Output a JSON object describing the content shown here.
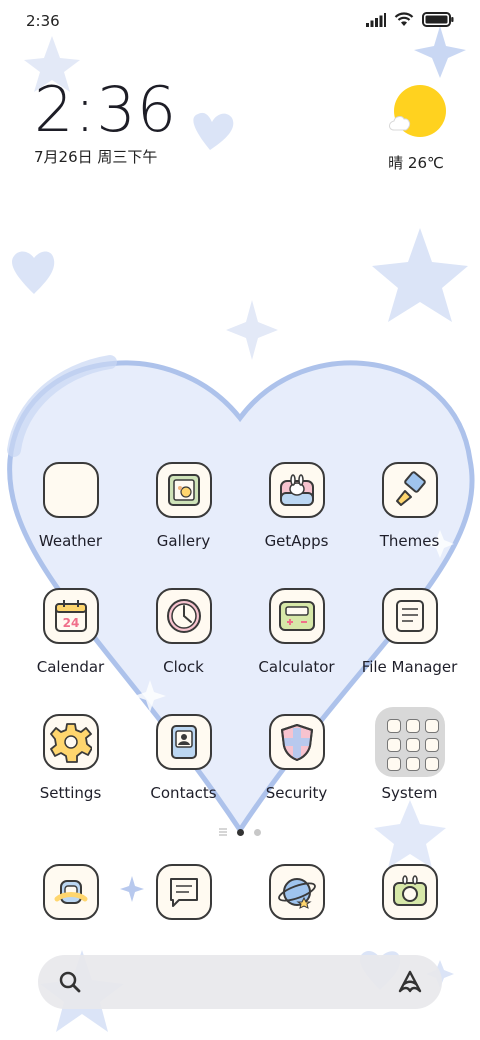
{
  "status_bar": {
    "time": "2:36"
  },
  "clock_widget": {
    "time": "2:36",
    "date": "7月26日 周三下午"
  },
  "weather_widget": {
    "text": "晴 26℃"
  },
  "apps": [
    {
      "label": "Weather",
      "icon": "weather-icon"
    },
    {
      "label": "Gallery",
      "icon": "gallery-icon"
    },
    {
      "label": "GetApps",
      "icon": "getapps-icon"
    },
    {
      "label": "Themes",
      "icon": "themes-icon"
    },
    {
      "label": "Calendar",
      "icon": "calendar-icon",
      "badge": "24"
    },
    {
      "label": "Clock",
      "icon": "clock-icon"
    },
    {
      "label": "Calculator",
      "icon": "calculator-icon"
    },
    {
      "label": "File Manager",
      "icon": "file-manager-icon"
    },
    {
      "label": "Settings",
      "icon": "settings-icon"
    },
    {
      "label": "Contacts",
      "icon": "contacts-icon"
    },
    {
      "label": "Security",
      "icon": "security-icon"
    },
    {
      "label": "System",
      "icon": "folder-icon"
    }
  ],
  "dock": [
    {
      "icon": "bunny-app-icon"
    },
    {
      "icon": "messages-icon"
    },
    {
      "icon": "browser-icon"
    },
    {
      "icon": "camera-icon"
    }
  ],
  "pages": {
    "count": 2,
    "current": 1
  },
  "colors": {
    "accent_blue": "#a9bfea",
    "sun": "#ffd21f",
    "icon_bg": "#fffaf1"
  }
}
